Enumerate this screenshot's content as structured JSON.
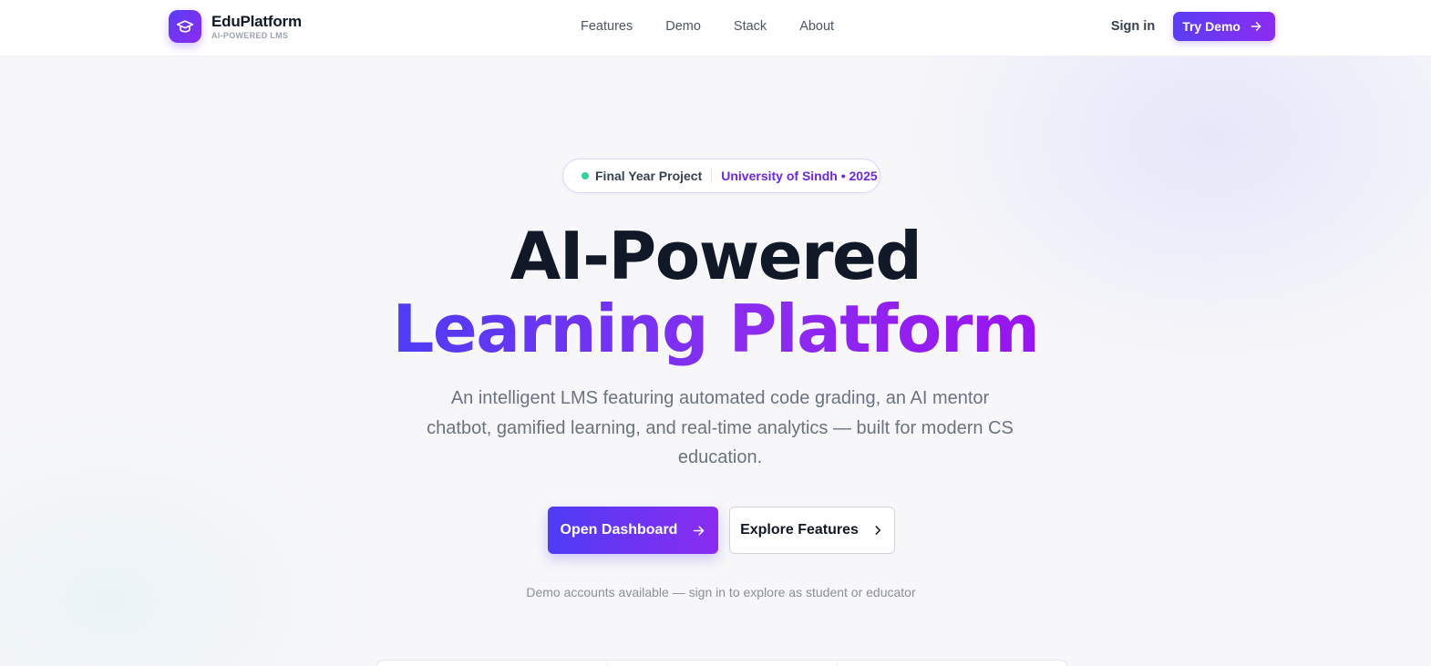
{
  "brand": {
    "name": "EduPlatform",
    "tagline": "AI-POWERED LMS",
    "logo_icon": "graduation-cap-icon"
  },
  "nav": {
    "links": [
      "Features",
      "Demo",
      "Stack",
      "About"
    ],
    "sign_in": "Sign in",
    "try_demo": "Try Demo"
  },
  "hero": {
    "badge": {
      "primary": "Final Year Project",
      "secondary": "University of Sindh • 2025"
    },
    "headline_line1": "AI-Powered",
    "headline_line2": "Learning Platform",
    "subtitle": "An intelligent LMS featuring automated code grading, an AI mentor chatbot, gamified learning, and real-time analytics — built for modern CS education.",
    "primary_cta": "Open Dashboard",
    "secondary_cta": "Explore Features",
    "hint": "Demo accounts available — sign in to explore as student or educator"
  },
  "colors": {
    "accent_start": "#4f3cf5",
    "accent_end": "#8b2cf0",
    "badge_dot": "#34d399"
  }
}
